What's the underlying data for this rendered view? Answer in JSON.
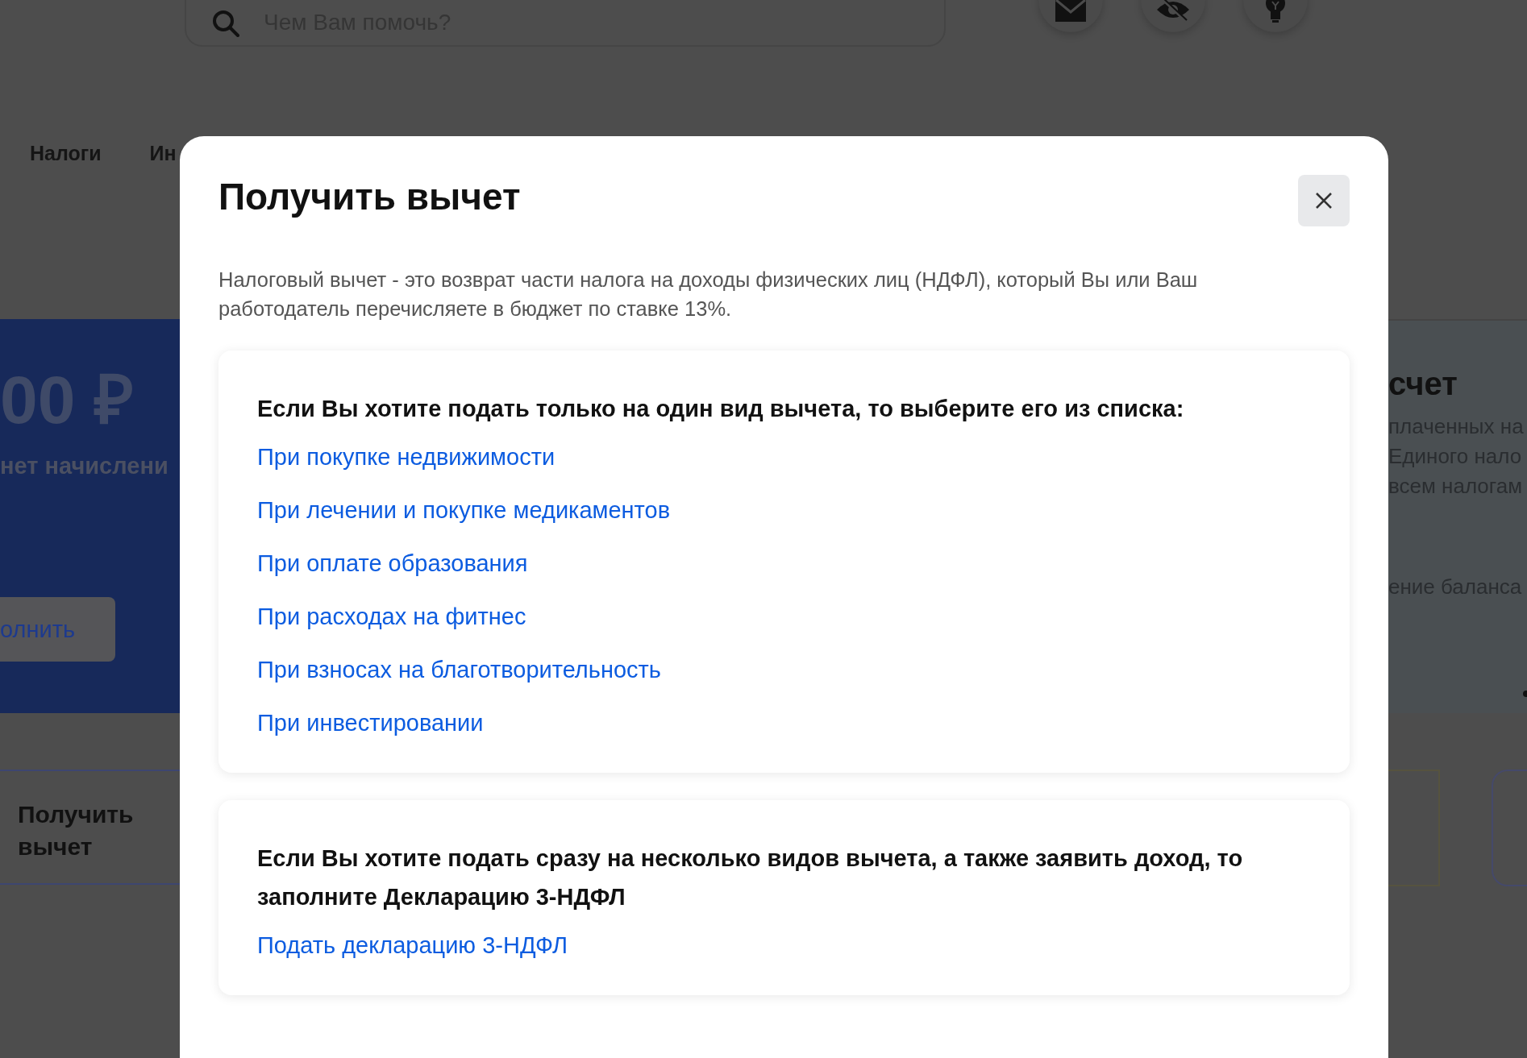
{
  "header": {
    "search": {
      "placeholder": "Чем Вам помочь?"
    }
  },
  "nav": {
    "items": [
      "Налоги",
      "Ин"
    ]
  },
  "balance_banner": {
    "amount": "00 ₽",
    "note": "нет начислени",
    "button": "олнить"
  },
  "account_card": {
    "title": "счет",
    "lines": [
      "плаченных на",
      "Единого нало",
      "всем налогам"
    ],
    "footer": "ение баланса"
  },
  "service_cards": [
    {
      "title": "Получить вычет"
    }
  ],
  "modal": {
    "title": "Получить вычет",
    "description": "Налоговый вычет - это возврат части налога на доходы физических лиц (НДФЛ), который Вы или Ваш работодатель перечисляете в бюджет по ставке 13%.",
    "sections": [
      {
        "heading": "Если Вы хотите подать только на один вид вычета, то выберите его из списка:",
        "links": [
          "При покупке недвижимости",
          "При лечении и покупке медикаментов",
          "При оплате образования",
          "При расходах на фитнес",
          "При взносах на благотворительность",
          "При инвестировании"
        ]
      },
      {
        "heading": "Если Вы хотите подать сразу на несколько видов вычета, а также заявить доход, то заполните Декларацию 3-НДФЛ",
        "links": [
          "Подать декларацию 3-НДФЛ"
        ]
      }
    ]
  }
}
